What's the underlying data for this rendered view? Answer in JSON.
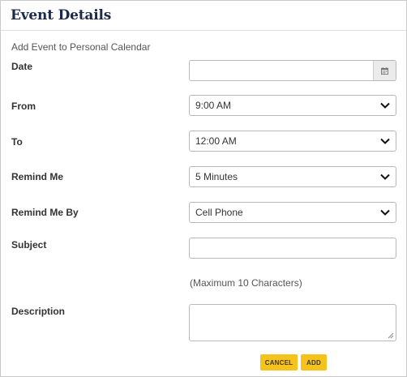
{
  "dialog": {
    "title": "Event Details",
    "subtitle": "Add Event to Personal Calendar"
  },
  "form": {
    "date": {
      "label": "Date",
      "value": "",
      "icon": "calendar-icon"
    },
    "from": {
      "label": "From",
      "value": "9:00 AM"
    },
    "to": {
      "label": "To",
      "value": "12:00 AM"
    },
    "remind_me": {
      "label": "Remind Me",
      "value": "5 Minutes"
    },
    "remind_me_by": {
      "label": "Remind Me By",
      "value": "Cell Phone"
    },
    "subject": {
      "label": "Subject",
      "value": "",
      "hint": "(Maximum 10 Characters)"
    },
    "description": {
      "label": "Description",
      "value": ""
    }
  },
  "buttons": {
    "cancel": "CANCEL",
    "add": "ADD"
  },
  "colors": {
    "title": "#1b2a4a",
    "button": "#f6c31d",
    "border": "#b9b9b9"
  }
}
